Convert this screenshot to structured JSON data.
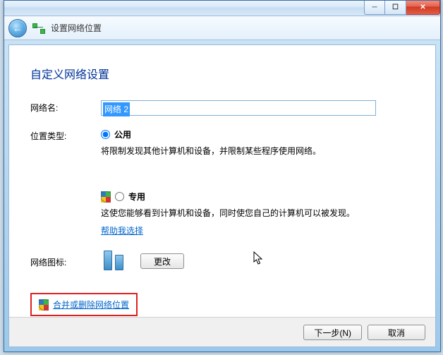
{
  "window": {
    "nav_title": "设置网络位置"
  },
  "page": {
    "heading": "自定义网络设置",
    "network_name_label": "网络名:",
    "network_name_value": "网络  2",
    "location_type_label": "位置类型:",
    "public": {
      "label": "公用",
      "desc": "将限制发现其他计算机和设备，并限制某些程序使用网络。"
    },
    "private": {
      "label": "专用",
      "desc": "这使您能够看到计算机和设备，同时使您自己的计算机可以被发现。"
    },
    "help_link": "帮助我选择",
    "icon_label": "网络图标:",
    "change_btn": "更改",
    "merge_link": "合并或删除网络位置"
  },
  "footer": {
    "next": "下一步(N)",
    "cancel": "取消"
  }
}
